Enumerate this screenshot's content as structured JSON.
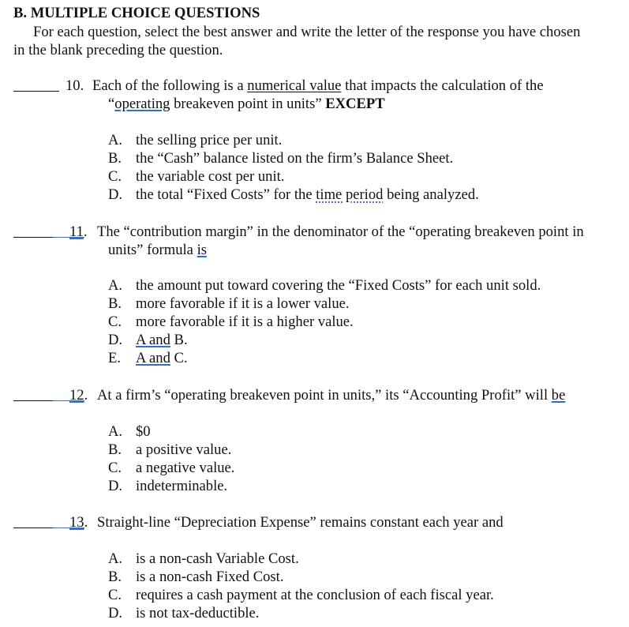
{
  "section": {
    "heading": "B.  MULTIPLE CHOICE QUESTIONS",
    "instructions_line1": "For each question, select the best answer and write the letter of the response you have chosen",
    "instructions_line2": "in the blank preceding the question."
  },
  "questions": [
    {
      "number": "10.",
      "line1_pre": "Each of the following is a ",
      "line1_ul": "numerical value",
      "line1_post": " that impacts the calculation of the",
      "line2_quote": "“",
      "line2_ul": "operating",
      "line2_post": " breakeven point in units” ",
      "line2_bold": "EXCEPT",
      "answer_blank": "",
      "options": [
        {
          "letter": "A.",
          "text": "the selling price per unit."
        },
        {
          "letter": "B.",
          "text": "the “Cash” balance listed on the firm’s Balance Sheet."
        },
        {
          "letter": "C.",
          "text": "the variable cost per unit."
        },
        {
          "letter": "D.",
          "pre": "the total “Fixed Costs” for the ",
          "ul": "time period",
          "post": " being analyzed."
        }
      ]
    },
    {
      "number_ul": "11",
      "number_post": ".",
      "line1": "The “contribution margin” in the denominator of the “operating breakeven point in",
      "line2_pre": "units” formula ",
      "line2_ul": "is",
      "answer_blank": "",
      "options": [
        {
          "letter": "A.",
          "text": "the amount put toward covering the “Fixed Costs” for each unit sold."
        },
        {
          "letter": "B.",
          "text": "more favorable if it is a lower value."
        },
        {
          "letter": "C.",
          "text": "more favorable if it is a higher value."
        },
        {
          "letter": "D.",
          "ul": "A and",
          "post": " B."
        },
        {
          "letter": "E.",
          "ul": "A and",
          "post": " C."
        }
      ]
    },
    {
      "number_ul": "12",
      "number_post": ".",
      "line1_pre": "At a firm’s “operating breakeven point in units,” its “Accounting Profit” will ",
      "line1_ul": "be",
      "answer_blank": "",
      "options": [
        {
          "letter": "A.",
          "text": "$0"
        },
        {
          "letter": "B.",
          "text": "a positive value."
        },
        {
          "letter": "C.",
          "text": "a negative value."
        },
        {
          "letter": "D.",
          "text": "indeterminable."
        }
      ]
    },
    {
      "number_ul": "13",
      "number_post": ".",
      "line1": "Straight-line “Depreciation Expense” remains constant each year and",
      "answer_blank": "",
      "options": [
        {
          "letter": "A.",
          "text": "is a non-cash Variable Cost."
        },
        {
          "letter": "B.",
          "text": "is a non-cash Fixed Cost."
        },
        {
          "letter": "C.",
          "text": "requires a cash payment at the conclusion of each fiscal year."
        },
        {
          "letter": "D.",
          "text": "is not tax-deductible."
        }
      ]
    }
  ]
}
